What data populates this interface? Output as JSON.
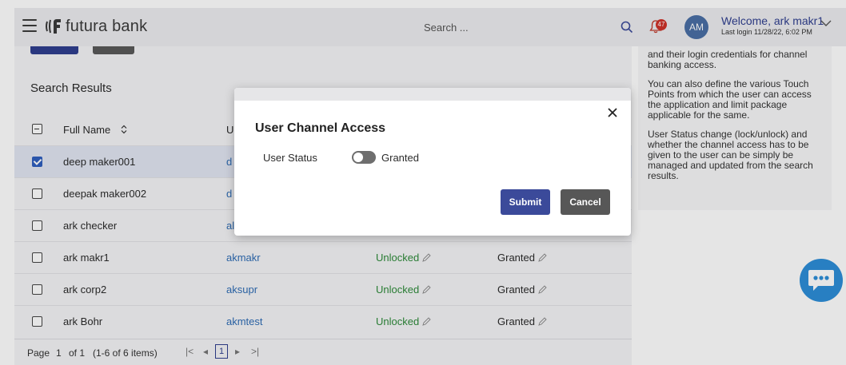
{
  "header": {
    "brand": "futura bank",
    "search_placeholder": "Search ...",
    "notification_count": "47",
    "avatar_initials": "AM",
    "welcome_text": "Welcome, ark makr1",
    "last_login": "Last login 11/28/22, 6:02 PM"
  },
  "main": {
    "results_title": "Search Results",
    "columns": [
      "Full Name",
      "U"
    ],
    "rows": [
      {
        "name": "deep maker001",
        "user": "d",
        "status": "",
        "access": "",
        "checked": true
      },
      {
        "name": "deepak maker002",
        "user": "d",
        "status": "",
        "access": "",
        "checked": false
      },
      {
        "name": "ark checker",
        "user": "al",
        "status": "",
        "access": "",
        "checked": false
      },
      {
        "name": "ark makr1",
        "user": "akmakr",
        "status": "Unlocked",
        "access": "Granted",
        "checked": false
      },
      {
        "name": "ark corp2",
        "user": "aksupr",
        "status": "Unlocked",
        "access": "Granted",
        "checked": false
      },
      {
        "name": "ark Bohr",
        "user": "akmtest",
        "status": "Unlocked",
        "access": "Granted",
        "checked": false
      }
    ],
    "pager": {
      "label": "Page",
      "current": "1",
      "of": "of 1",
      "items": "(1-6 of 6 items)",
      "first": "|<",
      "prev": "◂",
      "page_button": "1",
      "next": "▸",
      "last": ">|"
    }
  },
  "help": {
    "paragraphs": [
      "and their login credentials for channel banking access.",
      "You can also define the various Touch Points from which the user can access the application and limit package applicable for the same.",
      "User Status change (lock/unlock) and whether the channel access has to be given to the user can be simply be managed and updated from the search results."
    ]
  },
  "modal": {
    "title": "User Channel Access",
    "status_label": "User Status",
    "toggle_label": "Granted",
    "submit_label": "Submit",
    "cancel_label": "Cancel"
  },
  "colors": {
    "primary": "#3b4a9a",
    "link": "#2f6db5",
    "success": "#2e8b3a",
    "chatbot": "#2d8ed8"
  }
}
